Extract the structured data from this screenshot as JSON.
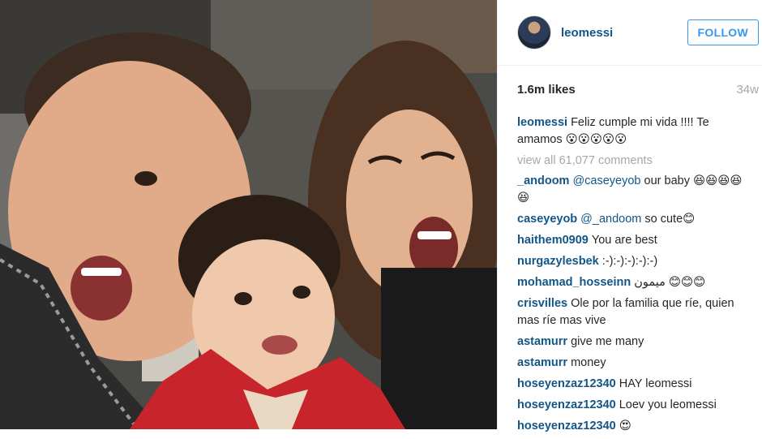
{
  "post": {
    "username": "leomessi",
    "follow_label": "FOLLOW",
    "likes": "1.6m likes",
    "time": "34w",
    "view_all": "view all 61,077 comments",
    "colors": {
      "link": "#125688",
      "follow": "#3897f0",
      "muted": "#a5a7aa"
    }
  },
  "caption": {
    "user": "leomessi",
    "text": "Feliz cumple mi vida !!!! Te amamos 😮😮😮😮😮"
  },
  "comments": [
    {
      "user": "_andoom",
      "mention": "@caseyeyob",
      "text": " our baby 😆😆😆😆😆"
    },
    {
      "user": "caseyeyob",
      "mention": "@_andoom",
      "text": " so cute😊"
    },
    {
      "user": "haithem0909",
      "text": "You are best"
    },
    {
      "user": "nurgazylesbek",
      "text": ":-):-):-):-):-)"
    },
    {
      "user": "mohamad_hosseinn",
      "text": "ميمون 😊😊😊"
    },
    {
      "user": "crisvilles",
      "text": "Ole por la familia que ríe, quien mas ríe mas vive"
    },
    {
      "user": "astamurr",
      "text": "give me many"
    },
    {
      "user": "astamurr",
      "text": "money"
    },
    {
      "user": "hoseyenzaz12340",
      "text": "HAY leomessi"
    },
    {
      "user": "hoseyenzaz12340",
      "text": "Loev you leomessi"
    },
    {
      "user": "hoseyenzaz12340",
      "text": "😍"
    }
  ]
}
